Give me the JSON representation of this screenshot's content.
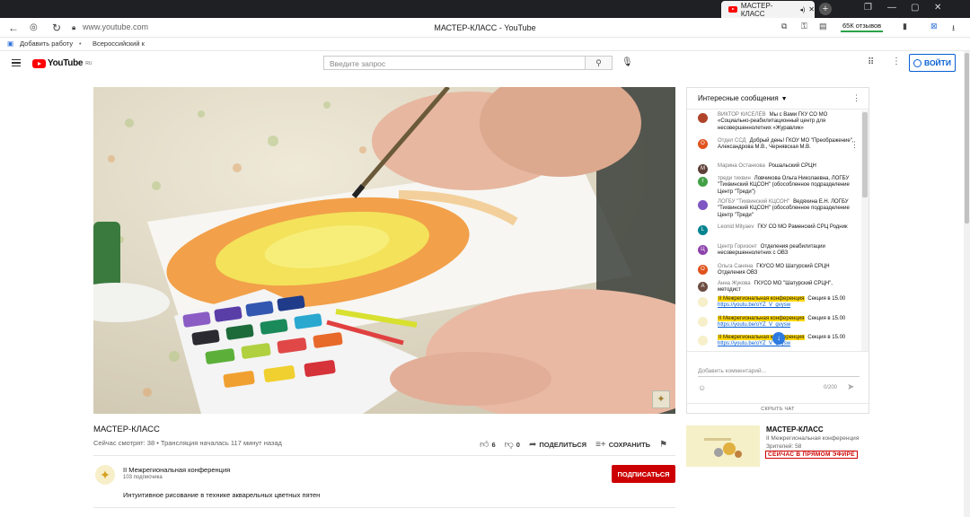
{
  "browser": {
    "tab_title": "МАСТЕР-КЛАСС",
    "url": "www.youtube.com",
    "page_title": "МАСТЕР-КЛАСС - YouTube",
    "reviews_label": "65К отзывов",
    "bookmarks": [
      "Добавить работу",
      "Всероссийский к"
    ]
  },
  "youtube": {
    "logo_text": "YouTube",
    "logo_region": "RU",
    "search_placeholder": "Введите запрос",
    "signin_label": "ВОЙТИ"
  },
  "video": {
    "title": "МАСТЕР-КЛАСС",
    "meta": "Сейчас смотрят: 38 • Трансляция началась 117 минут назад",
    "likes": "6",
    "dislikes": "0",
    "share_label": "ПОДЕЛИТЬСЯ",
    "save_label": "СОХРАНИТЬ"
  },
  "channel": {
    "name": "II Межрегиональная конференция",
    "subscribers": "103 подписчика",
    "subscribe_label": "ПОДПИСАТЬСЯ",
    "description": "Интуитивное рисование в технике акварельных цветных пятен"
  },
  "chat": {
    "header": "Интересные сообщения",
    "messages": [
      {
        "author": "ВИКТОР КИСЕЛЁВ",
        "text": "Мы с Вами ГКУ СО МО «Социально-реабилитационный центр для несовершеннолетних «Журавлик»",
        "avatar": "",
        "color": "#b0442b"
      },
      {
        "author": "Отдел ССД",
        "text": "Добрый день! ГКОУ МО \"Преображение\", Александрова М.В., Чернявская М.В.",
        "avatar": "О",
        "color": "#e0531e"
      },
      {
        "author": "Марина Останкова",
        "text": "Рошальский СРЦН",
        "avatar": "М",
        "color": "#5d4037"
      },
      {
        "author": "треди тихвин",
        "text": "Ловчикова Ольга Николаевна, ЛОГБУ \"Тихвинский КЦСОН\" (обособленное подразделение Центр \"Треди\")",
        "avatar": "т",
        "color": "#43a047"
      },
      {
        "author": "ЛОГБУ \"Тихвинский КЦСОН\"",
        "text": "Ведяхина Е.Н. ЛОГБУ \"Тихвинский КЦСОН\" (обособленное подразделение Центр \"Треди\"",
        "avatar": "",
        "color": "#7e57c2"
      },
      {
        "author": "Leonid Mityaev",
        "text": "ГКУ СО МО Раменский СРЦ Родник",
        "avatar": "L",
        "color": "#00838f"
      },
      {
        "author": "Центр Горизонт",
        "text": "Отделения реабилитации несовершеннолетних с ОВЗ",
        "avatar": "Ц",
        "color": "#8e44ad"
      },
      {
        "author": "Ольга Саняна",
        "text": "ГКУСО МО Шатурский СРЦН Отделения ОВЗ",
        "avatar": "О",
        "color": "#e0531e"
      },
      {
        "author": "Анна Жукова",
        "text": "ГКУСО МО \"Шатурский СРЦН\", методист",
        "avatar": "А",
        "color": "#6d4c41"
      },
      {
        "author": "II Межрегиональная конференция",
        "text": "Секция в 15.00",
        "link": "https://youtu.be/oYZ_V_gvysw",
        "avatar": "",
        "color": "#f6efc9",
        "highlight": true
      },
      {
        "author": "II Межрегиональная конференция",
        "text": "Секция в 15.00",
        "link": "https://youtu.be/oYZ_V_gvysw",
        "avatar": "",
        "color": "#f6efc9",
        "highlight": true
      },
      {
        "author": "II Межрегиональная конференция",
        "text": "Секция в 15.00",
        "link": "https://youtu.be/oYZ_V_gvysw",
        "avatar": "",
        "color": "#f6efc9",
        "highlight": true
      }
    ],
    "input_placeholder": "Добавить комментарий...",
    "counter": "0/200",
    "hide_label": "СКРЫТЬ ЧАТ"
  },
  "related": {
    "title": "МАСТЕР-КЛАСС",
    "channel": "II Межрегиональная конференция",
    "viewers": "Зрителей: 58",
    "live_badge": "СЕЙЧАС В ПРЯМОМ ЭФИРЕ"
  },
  "colors": {
    "subscribe": "#cc0000",
    "link": "#065fd4",
    "highlight": "#ffd600"
  }
}
